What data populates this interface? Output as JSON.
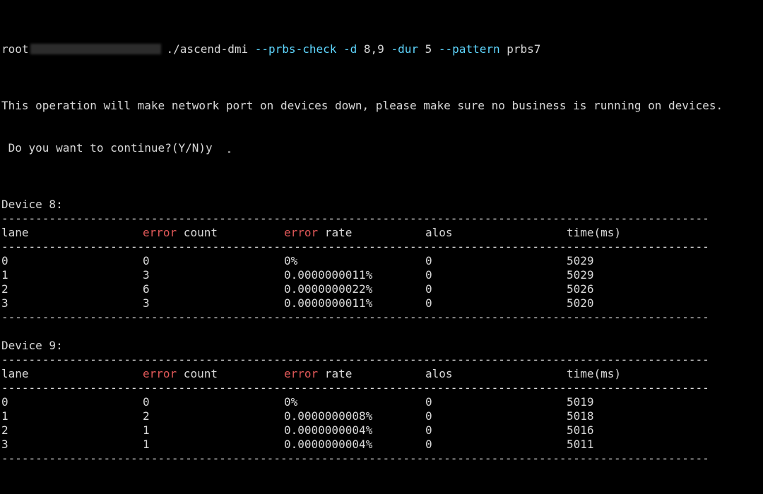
{
  "command": {
    "user": "root",
    "cmd": "./ascend-dmi",
    "flag_check": "--prbs-check",
    "flag_d": "-d",
    "arg_d": "8,9",
    "flag_dur": "-dur",
    "arg_dur": "5",
    "flag_pattern": "--pattern",
    "arg_pattern": "prbs7"
  },
  "warning": "This operation will make network port on devices down, please make sure no business is running on devices.",
  "prompt": " Do you want to continue?(Y/N)y",
  "separator": "------------------------------------------------------------------------------------------------------------------------------",
  "headers": {
    "lane": "lane",
    "error_word": "error",
    "count": " count",
    "rate": " rate",
    "alos": "alos",
    "time": "time(ms)"
  },
  "devices": [
    {
      "label": "Device 8:",
      "rows": [
        {
          "lane": "0",
          "count": "0",
          "rate": "0%",
          "alos": "0",
          "time": "5029"
        },
        {
          "lane": "1",
          "count": "3",
          "rate": "0.0000000011%",
          "alos": "0",
          "time": "5029"
        },
        {
          "lane": "2",
          "count": "6",
          "rate": "0.0000000022%",
          "alos": "0",
          "time": "5026"
        },
        {
          "lane": "3",
          "count": "3",
          "rate": "0.0000000011%",
          "alos": "0",
          "time": "5020"
        }
      ]
    },
    {
      "label": "Device 9:",
      "rows": [
        {
          "lane": "0",
          "count": "0",
          "rate": "0%",
          "alos": "0",
          "time": "5019"
        },
        {
          "lane": "1",
          "count": "2",
          "rate": "0.0000000008%",
          "alos": "0",
          "time": "5018"
        },
        {
          "lane": "2",
          "count": "1",
          "rate": "0.0000000004%",
          "alos": "0",
          "time": "5016"
        },
        {
          "lane": "3",
          "count": "1",
          "rate": "0.0000000004%",
          "alos": "0",
          "time": "5011"
        }
      ]
    }
  ],
  "colors": {
    "background": "#000000",
    "text": "#d8d8d8",
    "flag": "#5fd7ff",
    "error": "#e05858"
  }
}
